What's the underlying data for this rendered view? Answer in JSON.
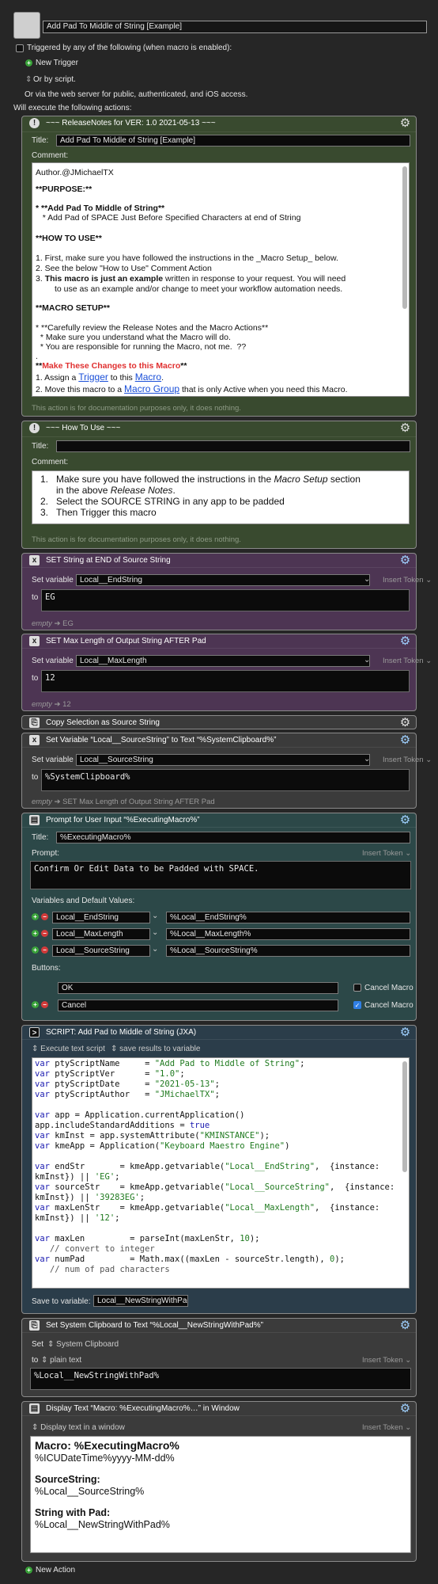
{
  "macro": {
    "name": "Add Pad To Middle of String [Example]",
    "triggered": "Triggered by any of the following (when macro is enabled):",
    "new_trigger": "New Trigger",
    "or_by_script": "Or by script.",
    "webserver": "Or via the web server for public, authenticated, and iOS access.",
    "will_execute": "Will execute the following actions:"
  },
  "a1": {
    "header": "~~~ ReleaseNotes for  VER: 1.0    2021-05-13 ~~~",
    "title_label": "Title:",
    "title_value": "Add Pad To Middle of String [Example]",
    "comment_label": "Comment:",
    "footer": "This action is for documentation purposes only, it does nothing.",
    "lines": [
      "Author.@JMichaelTX",
      "**PURPOSE:**",
      "* **Add Pad To Middle of String**",
      "   * Add Pad of SPACE Just Before Specified Characters at end of String",
      "**HOW TO USE**",
      "1. First, make sure you have followed the instructions in the _Macro Setup_ below.",
      "2. See the below \"How to Use\" Comment Action",
      "3.",
      "This macro is just an example",
      " written in response to your request. You will need",
      "to use as an example and/or change to meet your workflow automation needs.",
      "**MACRO SETUP**",
      "* **Carefully review the Release Notes and the Macro Actions**",
      "  * Make sure you understand what the Macro will do.",
      "  * You are responsible for running the Macro, not me.  ??",
      ".",
      "**",
      "Make These Changes to this Macro",
      "**",
      "1. Assign a ",
      "Trigger",
      " to this ",
      "Macro",
      ".",
      "2. Move this macro to a ",
      "Macro Group",
      " that is only Active when you need this Macro."
    ]
  },
  "a2": {
    "header": "~~~ How To Use ~~~",
    "title_label": "Title:",
    "title_value": "",
    "comment_label": "Comment:",
    "footer": "This action is for documentation purposes only, it does nothing.",
    "items": [
      "1.",
      "Make sure you have followed the instructions in the ",
      "Macro Setup",
      " section",
      "in the above ",
      "Release Notes",
      ".",
      "2.",
      "Select the SOURCE STRING in any app to be padded",
      "3.",
      "Then Trigger this macro"
    ]
  },
  "a3": {
    "header": "SET String at END of Source String",
    "set_label": "Set variable",
    "var": "Local__EndString",
    "insert": "Insert Token",
    "to": "to",
    "value": "EG",
    "empty": "empty",
    "result": "EG"
  },
  "a4": {
    "header": "SET Max Length of Output String AFTER Pad",
    "set_label": "Set variable",
    "var": "Local__MaxLength",
    "insert": "Insert Token",
    "to": "to",
    "value": "12",
    "empty": "empty",
    "result": "12"
  },
  "a5": {
    "header": "Copy Selection as Source String"
  },
  "a6": {
    "header": "Set Variable “Local__SourceString” to Text “%SystemClipboard%”",
    "set_label": "Set variable",
    "var": "Local__SourceString",
    "insert": "Insert Token",
    "to": "to",
    "value": "%SystemClipboard%",
    "empty": "empty",
    "result": "SET Max Length of Output String AFTER Pad"
  },
  "a7": {
    "header": "Prompt for User Input “%ExecutingMacro%”",
    "title_label": "Title:",
    "title_value": "%ExecutingMacro%",
    "prompt_label": "Prompt:",
    "insert": "Insert Token",
    "prompt_value": "Confirm Or Edit Data to be Padded with SPACE.",
    "vars_label": "Variables and Default Values:",
    "vars": [
      {
        "name": "Local__EndString",
        "value": "%Local__EndString%"
      },
      {
        "name": "Local__MaxLength",
        "value": "%Local__MaxLength%"
      },
      {
        "name": "Local__SourceString",
        "value": "%Local__SourceString%"
      }
    ],
    "buttons_label": "Buttons:",
    "buttons": [
      {
        "name": "OK",
        "cancel": "Cancel Macro",
        "checked": false
      },
      {
        "name": "Cancel",
        "cancel": "Cancel Macro",
        "checked": true
      }
    ]
  },
  "a8": {
    "header": "SCRIPT:  Add Pad to Middle of String (JXA)",
    "execute": "Execute text script",
    "save_results": "save results to variable",
    "save_to": "Save to variable:",
    "save_var": "Local__NewStringWithPad"
  },
  "a9": {
    "header": "Set System Clipboard to Text “%Local__NewStringWithPad%”",
    "set": "Set",
    "clipboard": "System Clipboard",
    "to": "to",
    "plain": "plain text",
    "insert": "Insert Token",
    "value": "%Local__NewStringWithPad%"
  },
  "a10": {
    "header": "Display Text “Macro:  %ExecutingMacro%…” in Window",
    "mode": "Display text in a window",
    "insert": "Insert Token",
    "l1": "Macro:  %ExecutingMacro%",
    "l2": "%ICUDateTime%yyyy-MM-dd%",
    "l3": "SourceString:",
    "l4": "%Local__SourceString%",
    "l5": "String with Pad:",
    "l6": "%Local__NewStringWithPad%"
  },
  "new_action": "New Action",
  "colors": {
    "green": "#394a2f",
    "purple": "#4d3553",
    "teal": "#2c4848",
    "red": "#e03030",
    "link": "#1a4fd8"
  }
}
